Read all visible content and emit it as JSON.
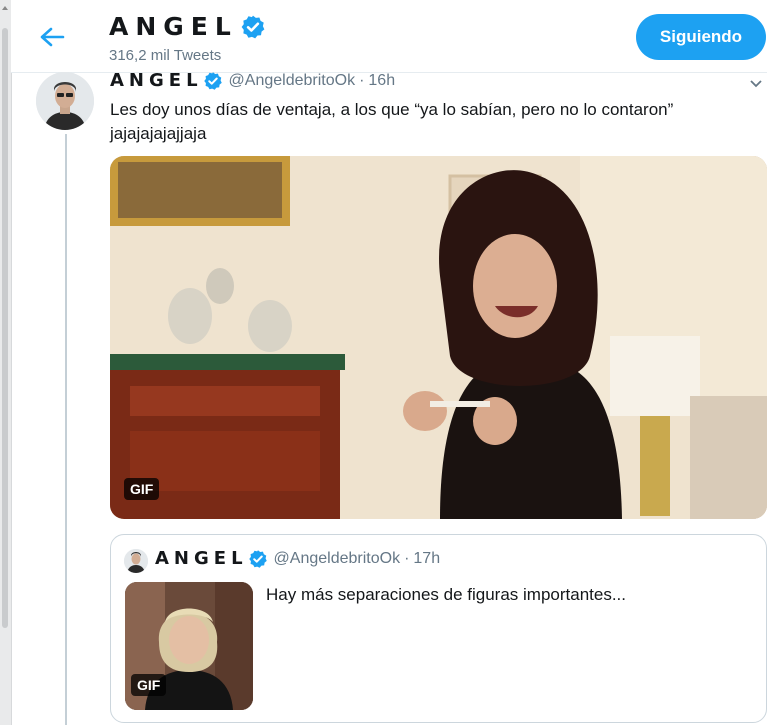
{
  "header": {
    "display_name": "ANGEL",
    "tweet_count": "316,2 mil Tweets",
    "follow_label": "Siguiendo",
    "back_icon": "arrow-left-icon",
    "verified_icon": "verified-badge-icon"
  },
  "tweet": {
    "display_name": "ANGEL",
    "handle": "@AngeldebritoOk",
    "separator": "·",
    "time": "16h",
    "text": "Les doy unos días de ventaja, a los que “ya lo sabían, pero no lo contaron” jajajajajajjaja",
    "media_badge": "GIF",
    "menu_icon": "chevron-down-icon"
  },
  "quoted_tweet": {
    "display_name": "ANGEL",
    "handle": "@AngeldebritoOk",
    "separator": "·",
    "time": "17h",
    "text": "Hay más separaciones de figuras importantes...",
    "media_badge": "GIF"
  },
  "colors": {
    "accent": "#1da1f2",
    "text": "#14171a",
    "muted": "#657786",
    "border": "#ccd6dd"
  }
}
